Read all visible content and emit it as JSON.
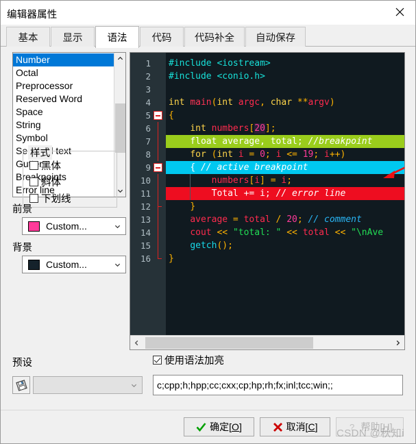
{
  "window": {
    "title": "编辑器属性",
    "close_icon": "close-icon"
  },
  "tabs": [
    {
      "label": "基本",
      "active": false
    },
    {
      "label": "显示",
      "active": false
    },
    {
      "label": "语法",
      "active": true
    },
    {
      "label": "代码",
      "active": false
    },
    {
      "label": "代码补全",
      "active": false
    },
    {
      "label": "自动保存",
      "active": false
    }
  ],
  "element_list": {
    "selected": "Number",
    "items": [
      "Number",
      "Octal",
      "Preprocessor",
      "Reserved Word",
      "Space",
      "String",
      "Symbol",
      "Selected text",
      "Gutter",
      "Breakpoints",
      "Error line"
    ]
  },
  "foreground": {
    "label": "前景",
    "value": "Custom...",
    "color": "#ff3b9a"
  },
  "background": {
    "label": "背景",
    "value": "Custom...",
    "color": "#15222b"
  },
  "style_group": {
    "title": "样式",
    "options": [
      {
        "label": "黑体",
        "checked": false
      },
      {
        "label": "斜体",
        "checked": false
      },
      {
        "label": "下划线",
        "checked": false
      }
    ]
  },
  "preset": {
    "label": "预设",
    "icon": "save-disk-icon",
    "value": "",
    "disabled": true
  },
  "syntax_highlight": {
    "label": "使用语法加亮",
    "checked": true
  },
  "extensions": {
    "value": "c;cpp;h;hpp;cc;cxx;cp;hp;rh;fx;inl;tcc;win;;"
  },
  "editor": {
    "background": "#101a20",
    "gutter_background": "#263238",
    "line_number_color": "#b0bec5",
    "breakpoint_line_color": "#9ACD1C",
    "active_breakpoint_color": "#00c8f0",
    "error_line_color": "#ee0d20",
    "lines": [
      {
        "num": 1,
        "bg": "",
        "fold": "",
        "tokens": [
          {
            "t": "#include ",
            "c": "t-pre"
          },
          {
            "t": "<iostream>",
            "c": "t-pre"
          }
        ]
      },
      {
        "num": 2,
        "bg": "",
        "fold": "",
        "tokens": [
          {
            "t": "#include ",
            "c": "t-pre"
          },
          {
            "t": "<conio.h>",
            "c": "t-pre"
          }
        ]
      },
      {
        "num": 3,
        "bg": "",
        "fold": "",
        "tokens": []
      },
      {
        "num": 4,
        "bg": "",
        "fold": "",
        "tokens": [
          {
            "t": "int ",
            "c": "t-kw"
          },
          {
            "t": "main",
            "c": "t-fn"
          },
          {
            "t": "(",
            "c": "t-punct"
          },
          {
            "t": "int ",
            "c": "t-kw"
          },
          {
            "t": "argc",
            "c": "t-id"
          },
          {
            "t": ", ",
            "c": "t-punct"
          },
          {
            "t": "char ",
            "c": "t-kw"
          },
          {
            "t": "**",
            "c": "t-op"
          },
          {
            "t": "argv",
            "c": "t-id"
          },
          {
            "t": ")",
            "c": "t-punct"
          }
        ]
      },
      {
        "num": 5,
        "bg": "",
        "fold": "box",
        "tokens": [
          {
            "t": "{",
            "c": "t-punct"
          }
        ]
      },
      {
        "num": 6,
        "bg": "",
        "fold": "line",
        "tokens": [
          {
            "t": "    ",
            "c": "t-plain"
          },
          {
            "t": "int ",
            "c": "t-kw"
          },
          {
            "t": "numbers",
            "c": "t-id"
          },
          {
            "t": "[",
            "c": "t-punct"
          },
          {
            "t": "20",
            "c": "sel-num"
          },
          {
            "t": "]",
            "c": "t-punct"
          },
          {
            "t": ";",
            "c": "t-punct"
          }
        ]
      },
      {
        "num": 7,
        "bg": "#9ACD1C",
        "fold": "line",
        "tokens": [
          {
            "t": "    ",
            "c": "t-plain"
          },
          {
            "t": "float ",
            "c": "t-lw"
          },
          {
            "t": "average",
            "c": "t-lw2"
          },
          {
            "t": ", ",
            "c": "t-lw2"
          },
          {
            "t": "total",
            "c": "t-lw2"
          },
          {
            "t": "; ",
            "c": "t-lw2"
          },
          {
            "t": "//breakpoint",
            "c": "t-lc"
          }
        ]
      },
      {
        "num": 8,
        "bg": "",
        "fold": "line",
        "tokens": [
          {
            "t": "    ",
            "c": "t-plain"
          },
          {
            "t": "for ",
            "c": "t-kw"
          },
          {
            "t": "(",
            "c": "t-punct"
          },
          {
            "t": "int ",
            "c": "t-kw"
          },
          {
            "t": "i",
            "c": "t-id"
          },
          {
            "t": " = ",
            "c": "t-op"
          },
          {
            "t": "0",
            "c": "t-num"
          },
          {
            "t": "; ",
            "c": "t-punct"
          },
          {
            "t": "i",
            "c": "t-id"
          },
          {
            "t": " <= ",
            "c": "t-op"
          },
          {
            "t": "19",
            "c": "t-num"
          },
          {
            "t": "; ",
            "c": "t-punct"
          },
          {
            "t": "i",
            "c": "t-id"
          },
          {
            "t": "++",
            "c": "t-op"
          },
          {
            "t": ")",
            "c": "t-punct"
          }
        ]
      },
      {
        "num": 9,
        "bg": "#00c8f0",
        "fold": "box",
        "tokens": [
          {
            "t": "    ",
            "c": "t-plain"
          },
          {
            "t": "{ ",
            "c": "t-cw"
          },
          {
            "t": "// active breakpoint",
            "c": "t-cc"
          }
        ]
      },
      {
        "num": 10,
        "bg": "",
        "fold": "line",
        "tokens": [
          {
            "t": "        ",
            "c": "t-plain"
          },
          {
            "t": "numbers",
            "c": "t-id"
          },
          {
            "t": "[",
            "c": "t-punct"
          },
          {
            "t": "i",
            "c": "t-id"
          },
          {
            "t": "]",
            "c": "t-punct"
          },
          {
            "t": " = ",
            "c": "t-op"
          },
          {
            "t": "i",
            "c": "t-id"
          },
          {
            "t": ";",
            "c": "t-punct"
          }
        ]
      },
      {
        "num": 11,
        "bg": "#ee0d20",
        "fold": "line",
        "tokens": [
          {
            "t": "        ",
            "c": "t-plain"
          },
          {
            "t": "Total",
            "c": "t-ew"
          },
          {
            "t": " += ",
            "c": "t-ew"
          },
          {
            "t": "i",
            "c": "t-ew"
          },
          {
            "t": "; ",
            "c": "t-ew"
          },
          {
            "t": "// error line",
            "c": "t-ec"
          }
        ]
      },
      {
        "num": 12,
        "bg": "",
        "fold": "tick",
        "tokens": [
          {
            "t": "    ",
            "c": "t-plain"
          },
          {
            "t": "}",
            "c": "t-punct"
          }
        ]
      },
      {
        "num": 13,
        "bg": "",
        "fold": "line",
        "tokens": [
          {
            "t": "    ",
            "c": "t-plain"
          },
          {
            "t": "average",
            "c": "t-id"
          },
          {
            "t": " = ",
            "c": "t-op"
          },
          {
            "t": "total",
            "c": "t-id"
          },
          {
            "t": " / ",
            "c": "t-op"
          },
          {
            "t": "20",
            "c": "t-num"
          },
          {
            "t": "; ",
            "c": "t-punct"
          },
          {
            "t": "// comment",
            "c": "t-cmt"
          }
        ]
      },
      {
        "num": 14,
        "bg": "",
        "fold": "line",
        "tokens": [
          {
            "t": "    ",
            "c": "t-plain"
          },
          {
            "t": "cout",
            "c": "t-id"
          },
          {
            "t": " << ",
            "c": "t-op"
          },
          {
            "t": "\"total: \"",
            "c": "t-str"
          },
          {
            "t": " << ",
            "c": "t-op"
          },
          {
            "t": "total",
            "c": "t-id"
          },
          {
            "t": " << ",
            "c": "t-op"
          },
          {
            "t": "\"\\nAve",
            "c": "t-str"
          }
        ]
      },
      {
        "num": 15,
        "bg": "",
        "fold": "line",
        "tokens": [
          {
            "t": "    ",
            "c": "t-plain"
          },
          {
            "t": "getch",
            "c": "t-cyan"
          },
          {
            "t": "()",
            "c": "t-punct"
          },
          {
            "t": ";",
            "c": "t-punct"
          }
        ]
      },
      {
        "num": 16,
        "bg": "",
        "fold": "end",
        "tokens": [
          {
            "t": "}",
            "c": "t-punct"
          }
        ]
      }
    ]
  },
  "buttons": {
    "ok": {
      "text": "确定[",
      "accel": "O",
      "close": "]",
      "icon": "check-icon",
      "icon_color": "#00a000"
    },
    "cancel": {
      "text": "取消[",
      "accel": "C",
      "close": "]",
      "icon": "cross-icon",
      "icon_color": "#cc0000"
    },
    "help": {
      "text": "帮助[",
      "accel": "H",
      "close": "]",
      "icon": "question-icon",
      "disabled": true
    }
  },
  "watermark": "CSDN @秋知i"
}
